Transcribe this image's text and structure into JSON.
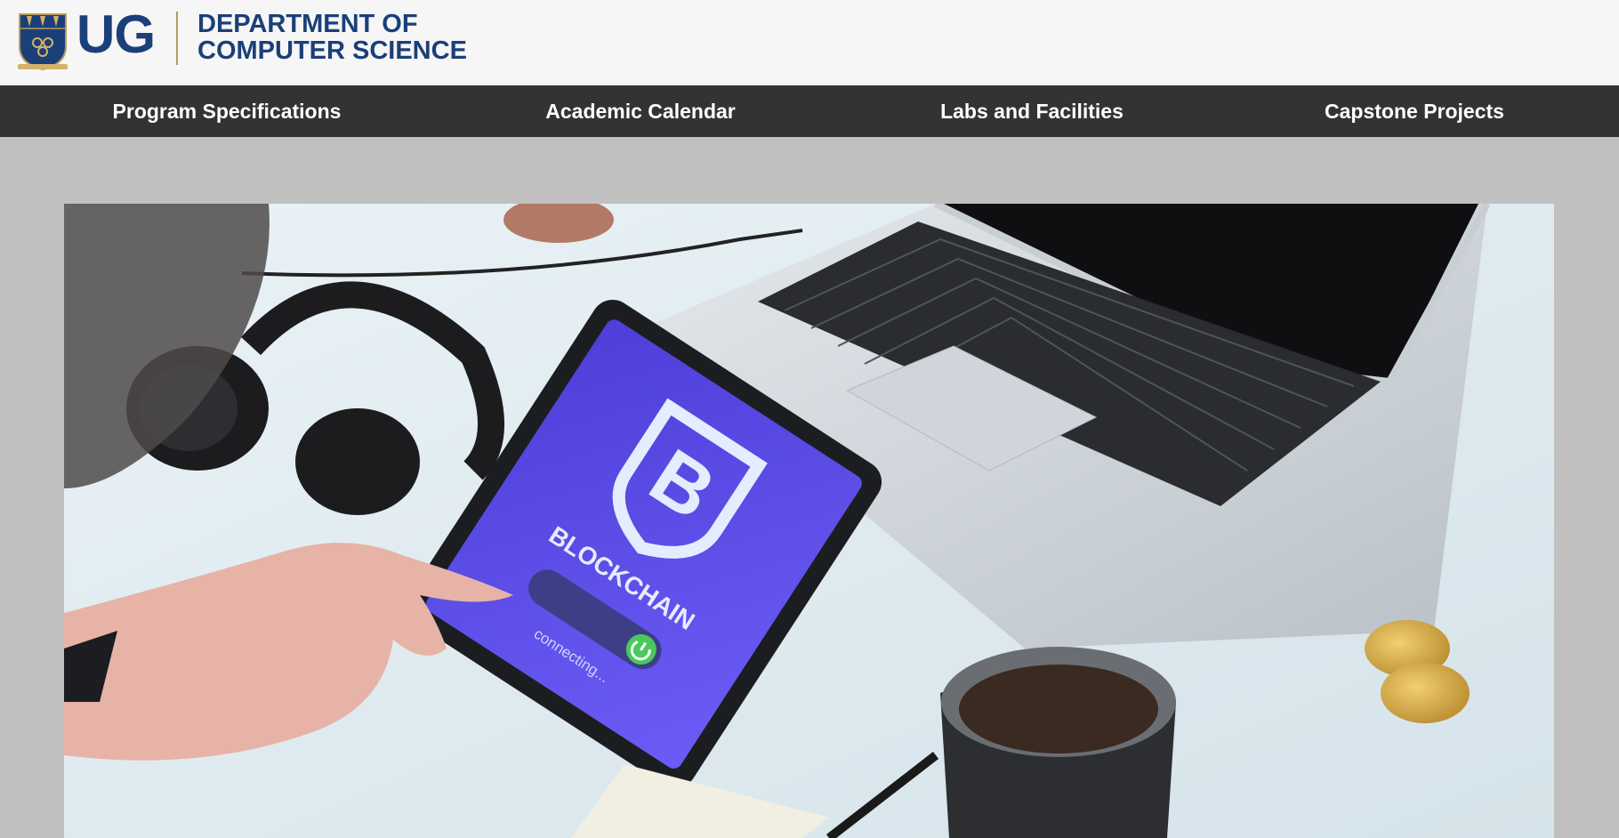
{
  "header": {
    "logo_text": "UG",
    "department_line1": "DEPARTMENT OF",
    "department_line2": "COMPUTER SCIENCE"
  },
  "nav": {
    "items": [
      {
        "label": "Program Specifications"
      },
      {
        "label": "Academic Calendar"
      },
      {
        "label": "Labs and Facilities"
      },
      {
        "label": "Capstone Projects"
      }
    ]
  },
  "hero": {
    "tablet_brand_text": "BLOCKCHAIN",
    "tablet_status_text": "connecting..."
  },
  "colors": {
    "brand_navy": "#1b3f78",
    "brand_gold": "#b79a5e",
    "nav_background": "#333333",
    "page_background": "#c1c0c1"
  }
}
